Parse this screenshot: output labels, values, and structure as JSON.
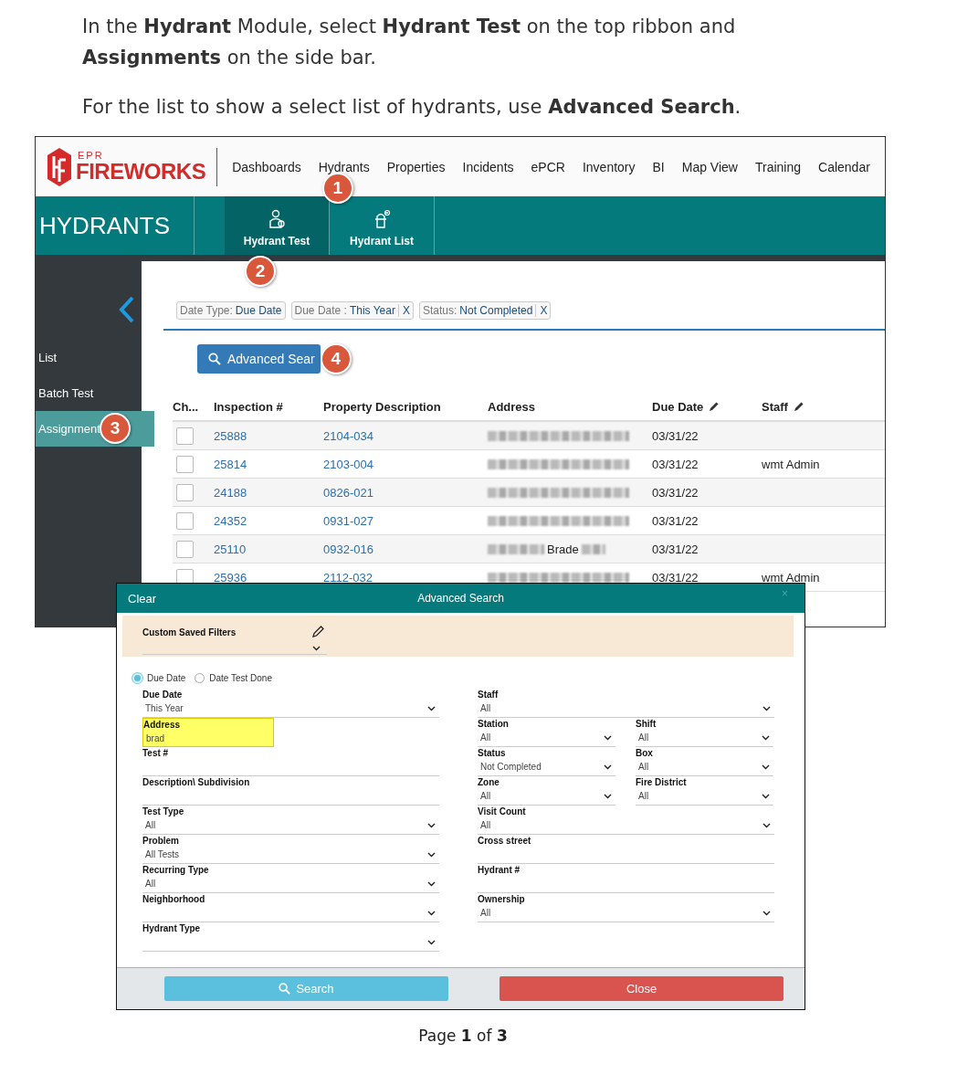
{
  "instructions": [
    "In the **Hydrant** Module, select **Hydrant Test** on the top ribbon and **Assignments** on the side bar.",
    "For the list to show a select list of hydrants, use **Advanced Search**."
  ],
  "app": {
    "logo": {
      "small": "EPR",
      "name": "FIREWORKS"
    },
    "nav": [
      {
        "label": "Dashboards"
      },
      {
        "label": "Hydrants",
        "callout": "1"
      },
      {
        "label": "Properties"
      },
      {
        "label": "Incidents"
      },
      {
        "label": "ePCR"
      },
      {
        "label": "Inventory"
      },
      {
        "label": "BI"
      },
      {
        "label": "Map View"
      },
      {
        "label": "Training"
      },
      {
        "label": "Calendar"
      }
    ],
    "module_title": "HYDRANTS",
    "ribbon": [
      {
        "label": "Hydrant Test",
        "selected": true,
        "callout": "2"
      },
      {
        "label": "Hydrant List",
        "selected": false
      }
    ],
    "sidebar": [
      {
        "label": "List",
        "selected": false
      },
      {
        "label": "Batch Test",
        "selected": false
      },
      {
        "label": "Assignment",
        "selected": true,
        "callout": "3"
      }
    ],
    "filters": [
      {
        "key": "Date Type:",
        "value": "Due Date",
        "removable": false
      },
      {
        "key": "Due Date :",
        "value": "This Year",
        "removable": true,
        "remove_label": "X"
      },
      {
        "key": "Status:",
        "value": "Not Completed",
        "removable": true,
        "remove_label": "X"
      }
    ],
    "advanced_search": {
      "label": "Advanced Sear",
      "callout": "4"
    },
    "table": {
      "columns": [
        {
          "label": "Ch...",
          "editable": false
        },
        {
          "label": "Inspection #",
          "editable": false
        },
        {
          "label": "Property Description",
          "editable": false
        },
        {
          "label": "Address",
          "editable": false
        },
        {
          "label": "Due Date",
          "editable": true
        },
        {
          "label": "Staff",
          "editable": true
        }
      ],
      "rows": [
        {
          "checked": false,
          "inspection": "25888",
          "property": "2104-034",
          "due": "03/31/22"
        },
        {
          "checked": false,
          "inspection": "25814",
          "property": "2103-004",
          "due": "03/31/22",
          "staff": "wmt Admin"
        },
        {
          "checked": false,
          "inspection": "24188",
          "property": "0826-021",
          "due": "03/31/22"
        },
        {
          "checked": false,
          "inspection": "24352",
          "property": "0931-027",
          "due": "03/31/22"
        },
        {
          "checked": false,
          "inspection": "25110",
          "property": "0932-016",
          "address_visible": "Brade",
          "due": "03/31/22"
        },
        {
          "checked": false,
          "inspection": "25936",
          "property": "2112-032",
          "due": "03/31/22",
          "staff": "wmt Admin"
        }
      ]
    }
  },
  "dialog": {
    "clear": "Clear",
    "title": "Advanced Search",
    "close_glyph": "×",
    "saved_filters": {
      "label": "Custom Saved Filters"
    },
    "date_mode": [
      {
        "label": "Due Date",
        "selected": true
      },
      {
        "label": "Date Test Done",
        "selected": false
      }
    ],
    "left_fields": [
      {
        "label": "Due Date",
        "kind": "select",
        "value": "This Year",
        "highlighted": false
      },
      {
        "label": "Address",
        "kind": "text",
        "value": "brad",
        "highlighted": true
      },
      {
        "label": "Test #",
        "kind": "text",
        "highlighted": false
      },
      {
        "label": "Description\\ Subdivision",
        "kind": "text",
        "highlighted": false
      },
      {
        "label": "Test Type",
        "kind": "select",
        "value": "All",
        "highlighted": false
      },
      {
        "label": "Problem",
        "kind": "select",
        "value": "All Tests",
        "highlighted": false
      },
      {
        "label": "Recurring Type",
        "kind": "select",
        "value": "All",
        "highlighted": false
      },
      {
        "label": "Neighborhood",
        "kind": "select",
        "highlighted": false
      },
      {
        "label": "Hydrant Type",
        "kind": "select",
        "highlighted": false
      }
    ],
    "right_rows": [
      [
        {
          "label": "Staff",
          "kind": "select",
          "value": "All",
          "highlighted": false
        }
      ],
      [
        {
          "label": "Station",
          "kind": "select",
          "value": "All",
          "highlighted": false
        },
        {
          "label": "Shift",
          "kind": "select",
          "value": "All",
          "highlighted": false
        }
      ],
      [
        {
          "label": "Status",
          "kind": "select",
          "value": "Not Completed",
          "highlighted": false
        },
        {
          "label": "Box",
          "kind": "select",
          "value": "All",
          "highlighted": false
        }
      ],
      [
        {
          "label": "Zone",
          "kind": "select",
          "value": "All",
          "highlighted": false
        },
        {
          "label": "Fire District",
          "kind": "select",
          "value": "All",
          "highlighted": false
        }
      ],
      [
        {
          "label": "Visit Count",
          "kind": "select",
          "value": "All",
          "highlighted": false
        }
      ],
      [
        {
          "label": "Cross street",
          "kind": "text",
          "highlighted": false
        }
      ],
      [
        {
          "label": "Hydrant #",
          "kind": "text",
          "highlighted": false
        }
      ],
      [
        {
          "label": "Ownership",
          "kind": "select",
          "value": "All",
          "highlighted": false
        }
      ]
    ],
    "buttons": [
      {
        "label": "Search",
        "kind": "search"
      },
      {
        "label": "Close",
        "kind": "close"
      }
    ]
  },
  "footer": "Page **1** of **3**"
}
